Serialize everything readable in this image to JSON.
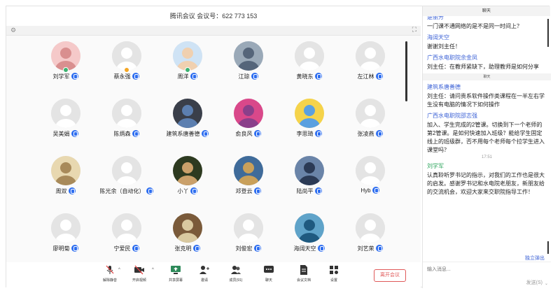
{
  "meeting": {
    "title": "腾讯会议 会议号：622 773 153"
  },
  "gridbar": {
    "left_icon": "dots-icon",
    "right_icon": "fullscreen-icon"
  },
  "participants": [
    {
      "name": "刘学军",
      "avatar": "photo",
      "badge": "#3cb371"
    },
    {
      "name": "蔡永强",
      "avatar": "default",
      "badge": "#f5a623"
    },
    {
      "name": "周洋",
      "avatar": "photo",
      "badge": "#3cb371"
    },
    {
      "name": "江琼",
      "avatar": "photo"
    },
    {
      "name": "黄晓东",
      "avatar": "default"
    },
    {
      "name": "左江林",
      "avatar": "default"
    },
    {
      "name": "吴美娟",
      "avatar": "default"
    },
    {
      "name": "陈炳森",
      "avatar": "default"
    },
    {
      "name": "建筑系唐善德",
      "avatar": "photo"
    },
    {
      "name": "俞良风",
      "avatar": "photo"
    },
    {
      "name": "李思琦",
      "avatar": "photo"
    },
    {
      "name": "张凌燕",
      "avatar": "default"
    },
    {
      "name": "周双",
      "avatar": "photo"
    },
    {
      "name": "陈光余（自动化）",
      "avatar": "default"
    },
    {
      "name": "小丫",
      "avatar": "photo"
    },
    {
      "name": "邓登云",
      "avatar": "photo"
    },
    {
      "name": "陆尚平",
      "avatar": "photo"
    },
    {
      "name": "Hyb",
      "avatar": "default"
    },
    {
      "name": "廖明菊",
      "avatar": "default"
    },
    {
      "name": "宁爱民",
      "avatar": "default"
    },
    {
      "name": "张克明",
      "avatar": "photo"
    },
    {
      "name": "刘俊宏",
      "avatar": "default"
    },
    {
      "name": "海阔天空",
      "avatar": "photo"
    },
    {
      "name": "刘艺荣",
      "avatar": "default"
    }
  ],
  "toolbar": {
    "mute": "解除静音",
    "video": "开启视频",
    "share": "共享屏幕",
    "invite": "邀请",
    "members": "成员(91)",
    "chat": "聊天",
    "docs": "会议文档",
    "settings": "设置",
    "leave": "离开会议"
  },
  "chat": {
    "header": "聊天",
    "messages": [
      {
        "sender": "楚丽芳",
        "text": "一门课不通网络的是不是同一时间上？"
      },
      {
        "sender": "海阔天空",
        "text": "谢谢刘主任！"
      },
      {
        "sender": "广西水电职院余金凤",
        "text": "刘主任：在教师紧缺下，助理教师是如何分享"
      },
      {
        "divider": "聊天"
      },
      {
        "sender": "建筑系唐善德",
        "text": "刘主任：请问贵系软件操作类课程在一半左右学生没有电脑的情况下如何操作"
      },
      {
        "sender": "广西水电职院邵志强",
        "text": "加入、学生完成的2管课。切换到下一个老师的第2管课。是如何快速加入班级？能给学生固定线上的班级群，否不用每个老师每个拉学生进入课堂吗？"
      },
      {
        "time": "17:51"
      },
      {
        "sender": "刘学军",
        "text": "认真聆听罗书记的指示，对我们的工作也是很大的启发。感谢罗书记和水电院老朋友，新朋友给的交流机会，欢迎大家来交职院指导工作！",
        "self": true
      }
    ],
    "popout": "独立弹出",
    "input_placeholder": "输入消息...",
    "send": "发送(S)"
  }
}
